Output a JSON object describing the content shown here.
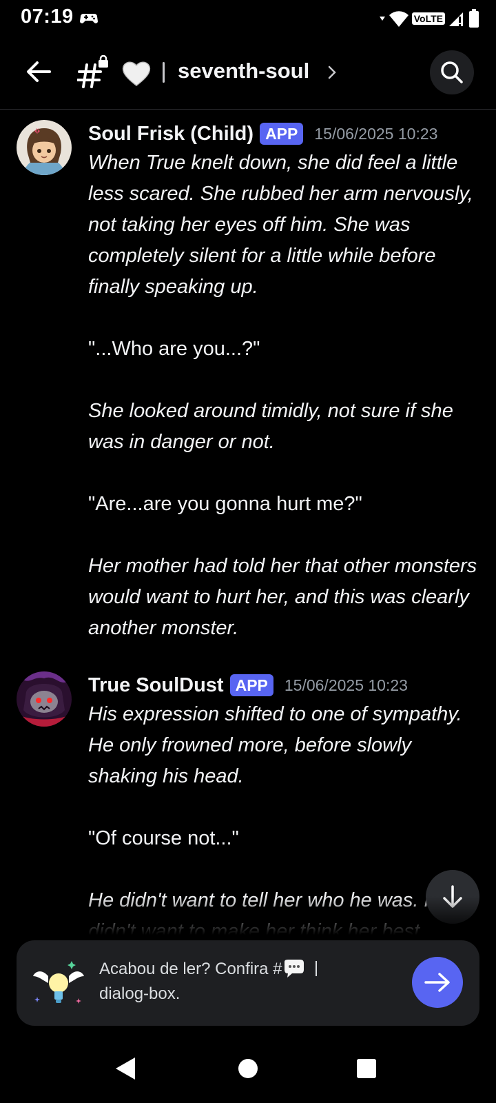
{
  "status_bar": {
    "time": "07:19",
    "network_label": "VoLTE",
    "icons": [
      "gamepad-icon",
      "wifi-icon",
      "volte-icon",
      "signal-icon",
      "battery-icon"
    ]
  },
  "header": {
    "channel_name": "seventh-soul",
    "icons": [
      "back-arrow-icon",
      "locked-hash-icon",
      "white-heart-icon",
      "chevron-right-icon",
      "search-icon"
    ]
  },
  "messages": [
    {
      "author": "Soul Frisk (Child)",
      "badge": "APP",
      "timestamp": "15/06/2025 10:23",
      "paragraphs": [
        {
          "text": "When True knelt down, she did feel a little less scared. She rubbed her arm nervously, not taking her eyes off him. She was completely silent for a little while before finally speaking up.",
          "italic": true
        },
        {
          "text": "\"...Who are you...?\"",
          "italic": false
        },
        {
          "text": "She looked around timidly, not sure if she was in danger or not.",
          "italic": true
        },
        {
          "text": "\"Are...are you gonna hurt me?\"",
          "italic": false
        },
        {
          "text": "Her mother had told her that other monsters would want to hurt her, and this was clearly another monster.",
          "italic": true
        }
      ]
    },
    {
      "author": "True SoulDust",
      "badge": "APP",
      "timestamp": "15/06/2025 10:23",
      "paragraphs": [
        {
          "text": "His expression shifted to one of sympathy. He only frowned more, before slowly shaking his head.",
          "italic": true
        },
        {
          "text": "\"Of course not...\"",
          "italic": false
        },
        {
          "text": "He didn't want to tell her who he was. He didn't want to make her think her best",
          "italic": true
        }
      ]
    }
  ],
  "promo": {
    "text_line1": "Acabou de ler? Confira #",
    "text_line2": "dialog-box.",
    "icons": [
      "winged-lightbulb-icon",
      "speech-bubble-icon",
      "arrow-right-icon"
    ]
  },
  "colors": {
    "background": "#000000",
    "accent": "#5865f2",
    "timestamp": "#949ba4",
    "banner": "#1e1f22"
  }
}
